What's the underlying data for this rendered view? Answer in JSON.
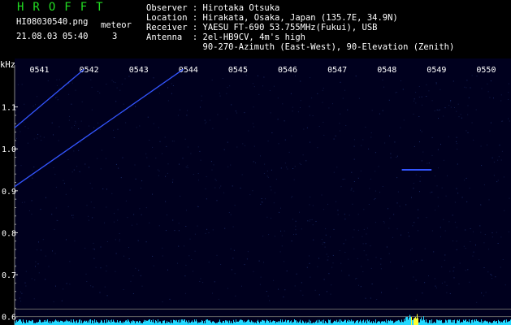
{
  "header": {
    "logo": "HROFFT",
    "filename": "HI08030540.png",
    "datetime": "21.08.03 05:40",
    "meteor_label": "meteor",
    "meteor_count": "3",
    "observer": "Observer : Hirotaka Otsuka",
    "location": "Location : Hirakata, Osaka, Japan (135.7E, 34.9N)",
    "receiver": "Receiver : YAESU FT-690 53.755MHz(Fukui), USB",
    "antenna": "Antenna  : 2el-HB9CV, 4m's high",
    "antenna2": "           90-270-Azimuth (East-West), 90-Elevation (Zenith)"
  },
  "colors": {
    "logo": "#22dd22",
    "trail": "#3355ff",
    "baseline": "#22d8ff",
    "background": "#00001e"
  },
  "chart_data": {
    "type": "spectrogram",
    "ylabel": "kHz",
    "y_ticks": [
      "1.1",
      "1.0",
      "0.9",
      "0.8",
      "0.7",
      "0.6"
    ],
    "ylim": [
      0.58,
      1.2
    ],
    "x_ticks": [
      "0541",
      "0542",
      "0543",
      "0544",
      "0545",
      "0546",
      "0547",
      "0548",
      "0549",
      "0550"
    ],
    "xlim_minutes": [
      0.0,
      10.0
    ],
    "traces": [
      {
        "label": "meteor echo",
        "points": [
          [
            0.0,
            1.05
          ],
          [
            1.4,
            1.19
          ]
        ]
      },
      {
        "label": "meteor echo",
        "points": [
          [
            0.0,
            0.91
          ],
          [
            3.4,
            1.19
          ]
        ]
      },
      {
        "label": "meteor echo",
        "points": [
          [
            7.8,
            0.95
          ],
          [
            8.4,
            0.95
          ]
        ]
      }
    ]
  }
}
